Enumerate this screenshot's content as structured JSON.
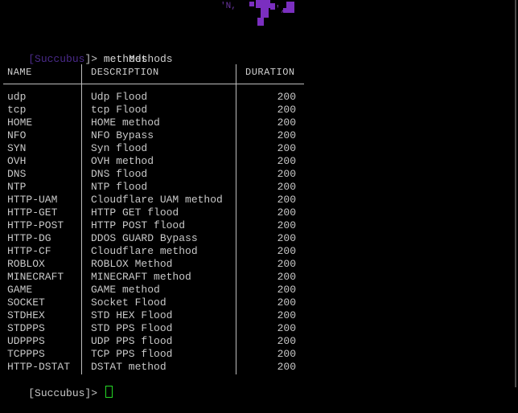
{
  "banner": {
    "left_text": "'N,",
    "right_text": "',"
  },
  "prompt": {
    "open_bracket": "[",
    "name": "Succubus",
    "close_and_symbol": "]> ",
    "command": "methods"
  },
  "table": {
    "title": "Methods",
    "headers": {
      "name": "NAME",
      "description": "DESCRIPTION",
      "duration": "DURATION"
    },
    "rows": [
      {
        "name": "udp",
        "description": "Udp Flood",
        "duration": "200"
      },
      {
        "name": "tcp",
        "description": "tcp Flood",
        "duration": "200"
      },
      {
        "name": "HOME",
        "description": "HOME method",
        "duration": "200"
      },
      {
        "name": "NFO",
        "description": "NFO Bypass",
        "duration": "200"
      },
      {
        "name": "SYN",
        "description": "Syn flood",
        "duration": "200"
      },
      {
        "name": "OVH",
        "description": "OVH method",
        "duration": "200"
      },
      {
        "name": "DNS",
        "description": "DNS flood",
        "duration": "200"
      },
      {
        "name": "NTP",
        "description": "NTP flood",
        "duration": "200"
      },
      {
        "name": "HTTP-UAM",
        "description": "Cloudflare UAM method",
        "duration": "200"
      },
      {
        "name": "HTTP-GET",
        "description": "HTTP GET flood",
        "duration": "200"
      },
      {
        "name": "HTTP-POST",
        "description": "HTTP POST flood",
        "duration": "200"
      },
      {
        "name": "HTTP-DG",
        "description": "DDOS GUARD Bypass",
        "duration": "200"
      },
      {
        "name": "HTTP-CF",
        "description": "Cloudflare method",
        "duration": "200"
      },
      {
        "name": "ROBLOX",
        "description": "ROBLOX Method",
        "duration": "200"
      },
      {
        "name": "MINECRAFT",
        "description": "MINECRAFT method",
        "duration": "200"
      },
      {
        "name": "GAME",
        "description": "GAME method",
        "duration": "200"
      },
      {
        "name": "SOCKET",
        "description": "Socket Flood",
        "duration": "200"
      },
      {
        "name": "STDHEX",
        "description": "STD HEX Flood",
        "duration": "200"
      },
      {
        "name": "STDPPS",
        "description": "STD PPS Flood",
        "duration": "200"
      },
      {
        "name": "UDPPPS",
        "description": "UDP PPS flood",
        "duration": "200"
      },
      {
        "name": "TCPPPS",
        "description": "TCP PPS flood",
        "duration": "200"
      },
      {
        "name": "HTTP-DSTAT",
        "description": "DSTAT method",
        "duration": "200"
      }
    ]
  },
  "bottom_prompt": {
    "text": "[Succubus]> "
  },
  "colors": {
    "background": "#000000",
    "text": "#c8c8c8",
    "prompt_name": "#4a2a8a",
    "banner_purple": "#7b2fc0",
    "cursor": "#25d825"
  }
}
